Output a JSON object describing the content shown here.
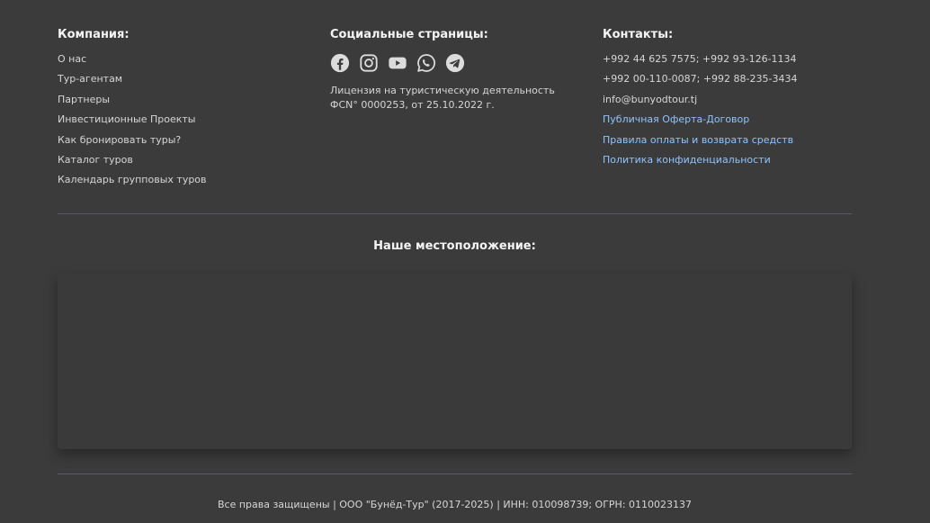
{
  "company": {
    "title": "Компания:",
    "links": [
      "О нас",
      "Тур-агентам",
      "Партнеры",
      "Инвестиционные Проекты",
      "Как бронировать туры?",
      "Каталог туров",
      "Календарь групповых туров"
    ]
  },
  "social": {
    "title": "Социальные страницы:",
    "icons": [
      "facebook-icon",
      "instagram-icon",
      "youtube-icon",
      "whatsapp-icon",
      "telegram-icon"
    ],
    "license": "Лицензия на туристическую деятельность ФСN° 0000253, от 25.10.2022 г."
  },
  "contacts": {
    "title": "Контакты:",
    "phones_1": "+992 44 625 7575; +992 93-126-1134",
    "phones_2": "+992 00-110-0087; +992 88-235-3434",
    "email": "info@bunyodtour.tj",
    "doc_links": [
      "Публичная Оферта-Договор",
      "Правила оплаты и возврата средств",
      "Политика конфиденциальности"
    ]
  },
  "location": {
    "title": "Наше местоположение:"
  },
  "footer": {
    "copyright": "Все права защищены | ООО \"Бунёд-Тур\" (2017-2025) | ИНН: 010098739; ОГРН: 0110023137"
  },
  "colors": {
    "background": "#3b3b3b",
    "text": "#d6d6d6",
    "heading": "#f4f4f4",
    "link_accent": "#8ec3ff",
    "divider": "#5a5a66"
  }
}
